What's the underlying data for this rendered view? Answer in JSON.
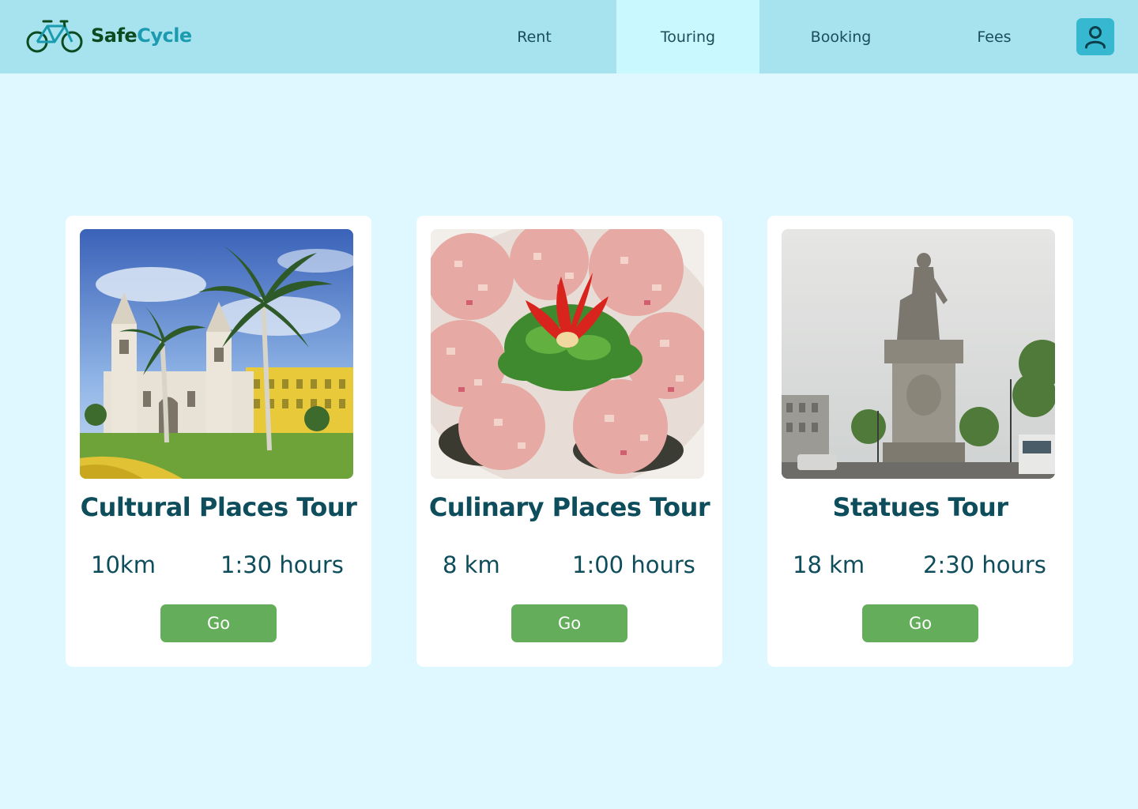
{
  "brand": {
    "name_part1": "Safe",
    "name_part2": "Cycle"
  },
  "nav": {
    "items": [
      {
        "label": "Rent"
      },
      {
        "label": "Touring",
        "active": true
      },
      {
        "label": "Booking"
      },
      {
        "label": "Fees"
      }
    ],
    "user_icon": "user-icon"
  },
  "colors": {
    "header_bg": "#a6e3ee",
    "page_bg": "#dff8ff",
    "active_tab": "#c9f9ff",
    "accent": "#36b8d0",
    "go_button": "#64ad5a",
    "text": "#0e4d5b"
  },
  "tours": [
    {
      "title": "Cultural Places Tour",
      "distance": "10km",
      "duration": "1:30 hours",
      "button": "Go",
      "image": "cathedral-plaza-photo"
    },
    {
      "title": "Culinary Places Tour",
      "distance": "8 km",
      "duration": "1:00 hours",
      "button": "Go",
      "image": "ceviche-dish-photo"
    },
    {
      "title": "Statues Tour",
      "distance": "18 km",
      "duration": "2:30 hours",
      "button": "Go",
      "image": "statue-monument-photo"
    }
  ]
}
